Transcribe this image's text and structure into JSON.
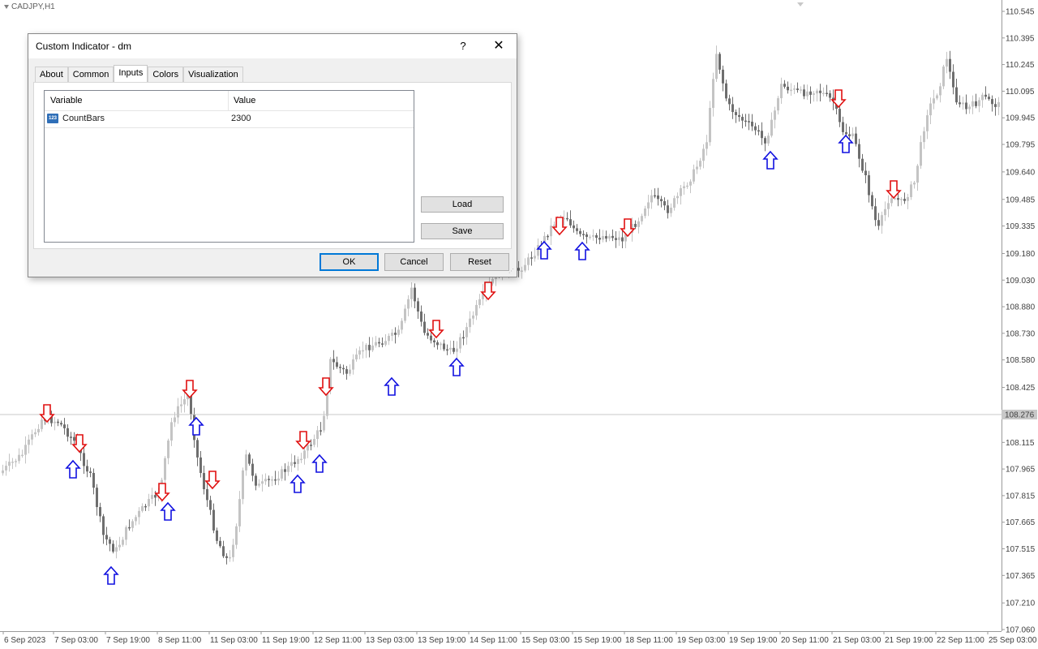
{
  "chart": {
    "symbol": "CADJPY,H1",
    "current_price": "108.276",
    "price_levels": [
      "110.545",
      "110.395",
      "110.245",
      "110.095",
      "109.945",
      "109.795",
      "109.640",
      "109.485",
      "109.335",
      "109.180",
      "109.030",
      "108.880",
      "108.730",
      "108.580",
      "108.425",
      "108.115",
      "107.965",
      "107.815",
      "107.665",
      "107.515",
      "107.365",
      "107.210",
      "107.060"
    ],
    "time_labels": [
      "6 Sep 2023",
      "7 Sep 03:00",
      "7 Sep 19:00",
      "8 Sep 11:00",
      "11 Sep 03:00",
      "11 Sep 19:00",
      "12 Sep 11:00",
      "13 Sep 03:00",
      "13 Sep 19:00",
      "14 Sep 11:00",
      "15 Sep 03:00",
      "15 Sep 19:00",
      "18 Sep 11:00",
      "19 Sep 03:00",
      "19 Sep 19:00",
      "20 Sep 11:00",
      "21 Sep 03:00",
      "21 Sep 19:00",
      "22 Sep 11:00",
      "25 Sep 03:00"
    ],
    "colors": {
      "background": "#ffffff",
      "candle_up": "#c4c4c4",
      "candle_down": "#6e6e6e",
      "arrow_up": "#1010e0",
      "arrow_down": "#e01010",
      "price_line": "#c8c8c8",
      "price_badge": "#c8c8c8"
    }
  },
  "dialog": {
    "title": "Custom Indicator - dm",
    "help": "?",
    "close": "✕",
    "tabs": [
      {
        "label": "About",
        "active": false
      },
      {
        "label": "Common",
        "active": false
      },
      {
        "label": "Inputs",
        "active": true
      },
      {
        "label": "Colors",
        "active": false
      },
      {
        "label": "Visualization",
        "active": false
      }
    ],
    "table": {
      "headers": [
        "Variable",
        "Value"
      ],
      "rows": [
        {
          "icon": "integer-param-icon",
          "variable": "CountBars",
          "value": "2300"
        }
      ]
    },
    "buttons": {
      "load": "Load",
      "save": "Save",
      "ok": "OK",
      "cancel": "Cancel",
      "reset": "Reset"
    }
  }
}
